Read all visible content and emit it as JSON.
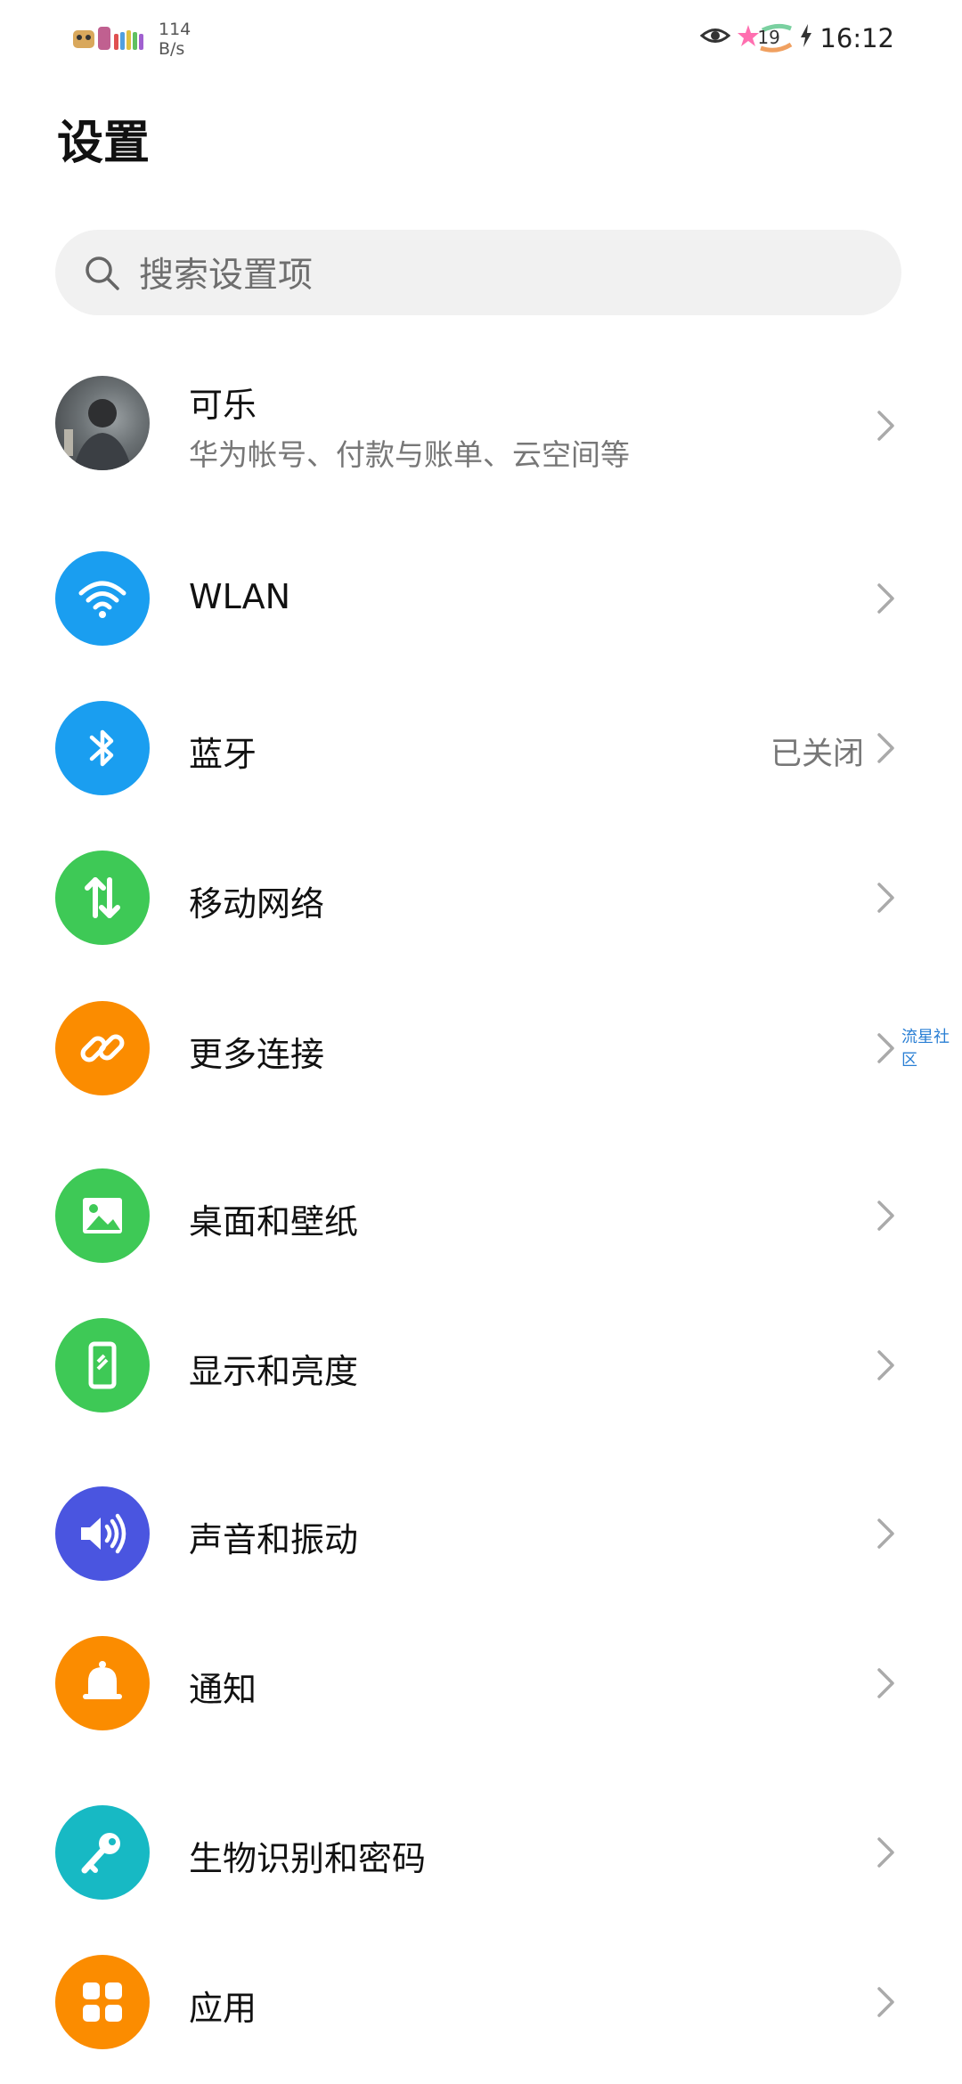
{
  "status_bar": {
    "net_speed": "114",
    "net_unit": "B/s",
    "badge_count": "19",
    "time": "16:12"
  },
  "page": {
    "title": "设置"
  },
  "search": {
    "placeholder": "搜索设置项"
  },
  "account": {
    "name": "可乐",
    "subtitle": "华为帐号、付款与账单、云空间等"
  },
  "items": [
    {
      "label": "WLAN",
      "icon": "wifi-icon",
      "color": "#1a9ef0"
    },
    {
      "label": "蓝牙",
      "value": "已关闭",
      "icon": "bluetooth-icon",
      "color": "#1a9ef0"
    },
    {
      "label": "移动网络",
      "icon": "mobile-data-icon",
      "color": "#3ec956"
    },
    {
      "label": "更多连接",
      "icon": "link-icon",
      "color": "#fb8c00"
    },
    {
      "label": "桌面和壁纸",
      "icon": "wallpaper-icon",
      "color": "#3ec956"
    },
    {
      "label": "显示和亮度",
      "icon": "display-icon",
      "color": "#3ec956"
    },
    {
      "label": "声音和振动",
      "icon": "sound-icon",
      "color": "#4a55e0"
    },
    {
      "label": "通知",
      "icon": "bell-icon",
      "color": "#fb8c00"
    },
    {
      "label": "生物识别和密码",
      "icon": "key-icon",
      "color": "#17b9c4"
    },
    {
      "label": "应用",
      "icon": "apps-icon",
      "color": "#fb8c00"
    }
  ],
  "watermark": "流星社区"
}
